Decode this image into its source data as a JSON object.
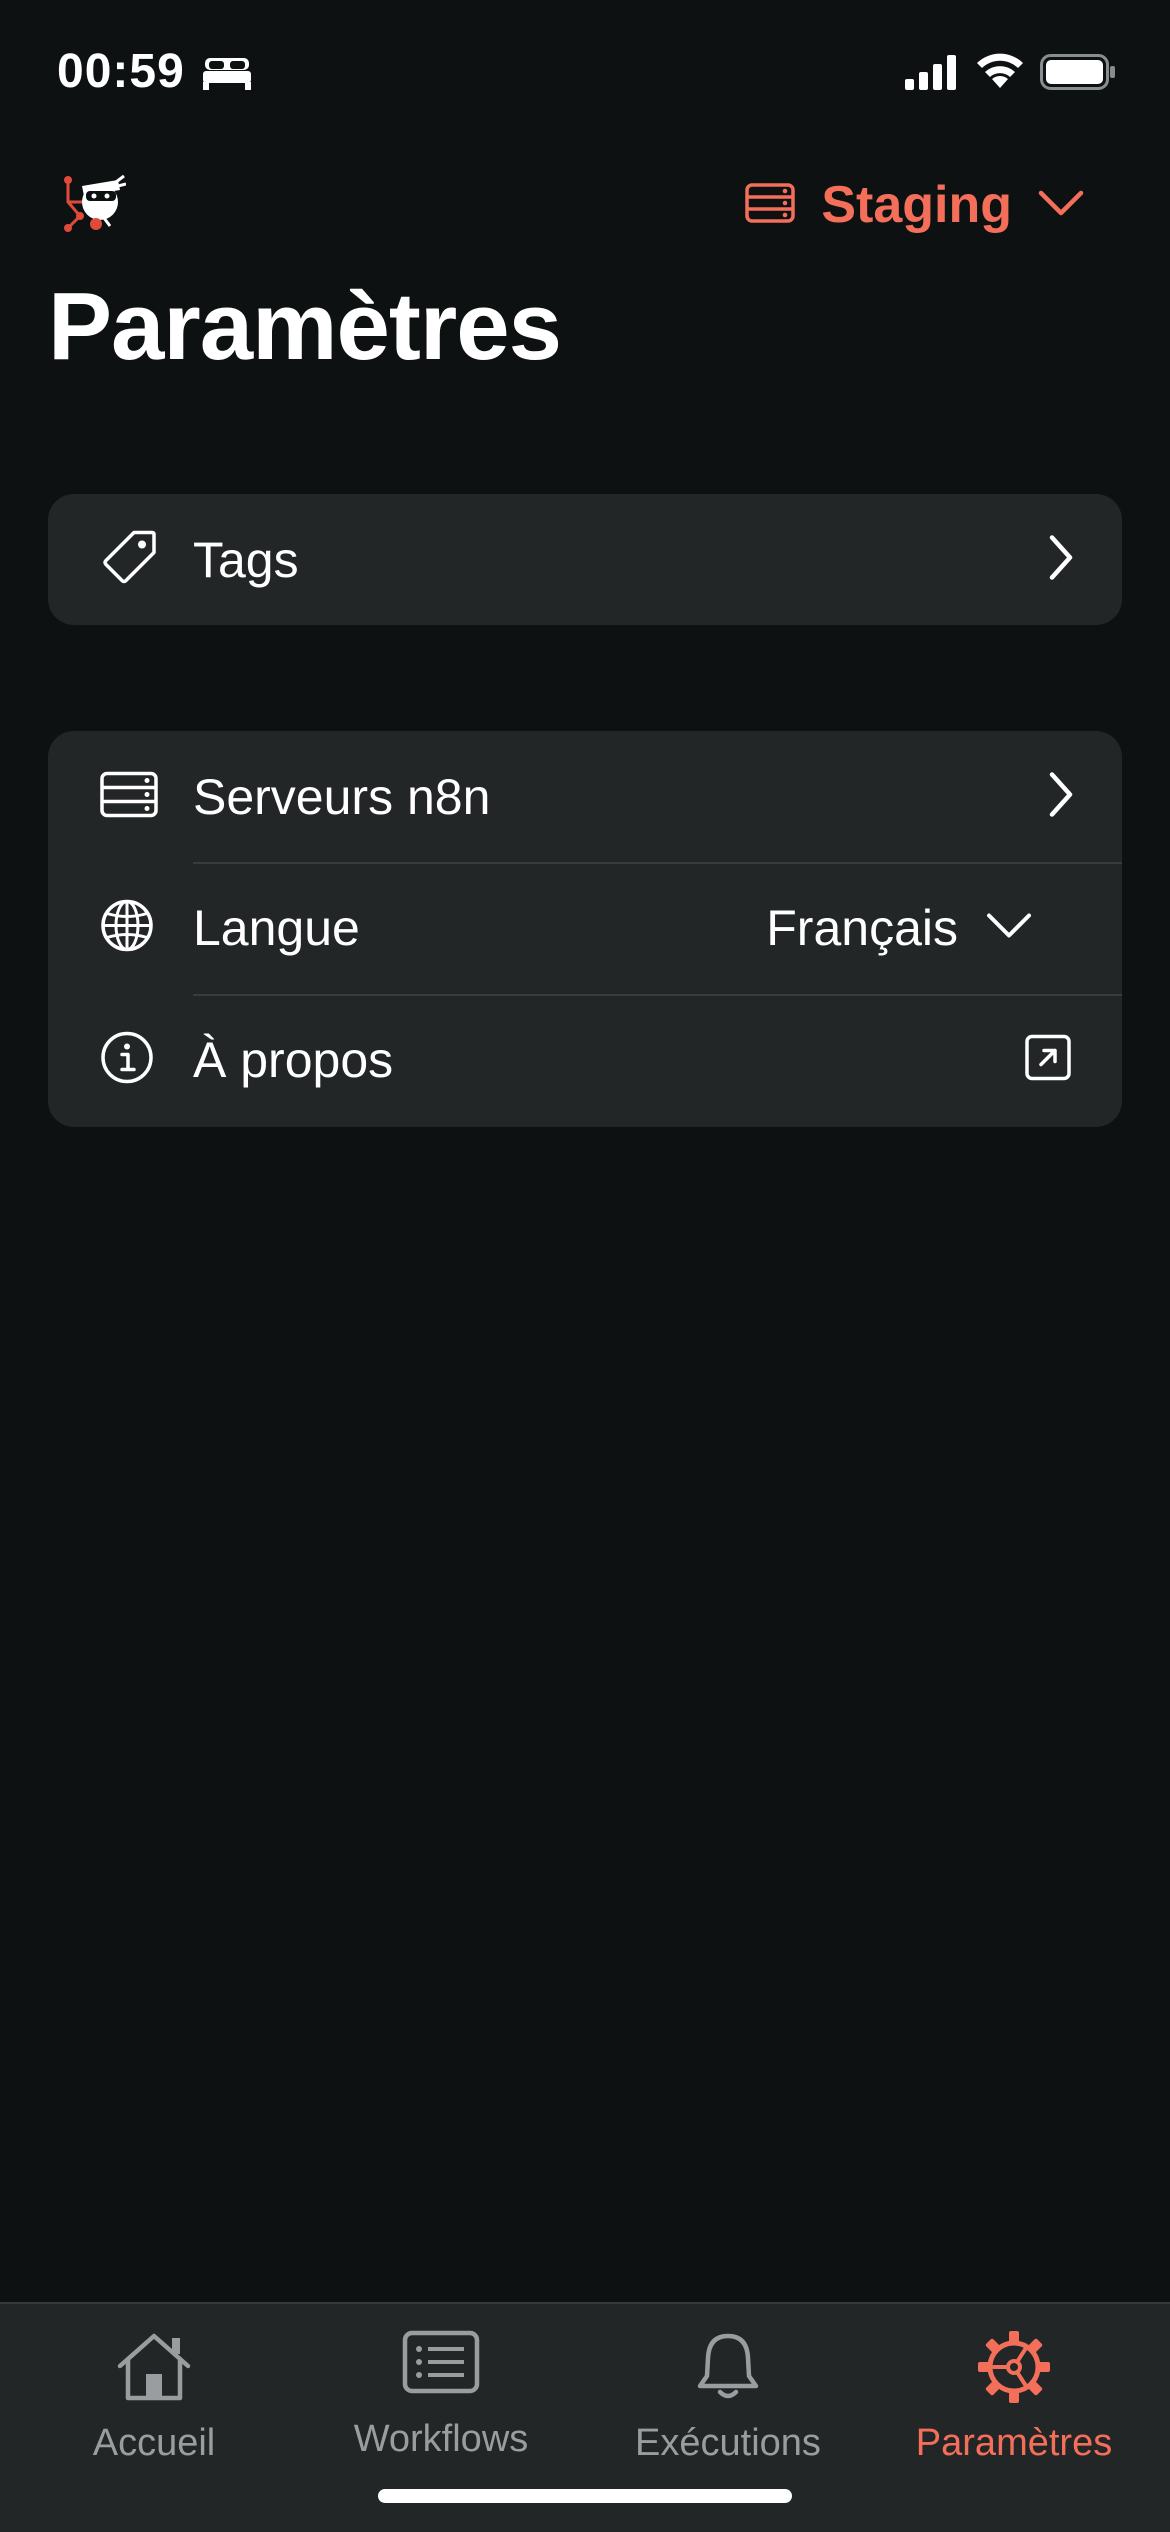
{
  "status_bar": {
    "time": "00:59",
    "icons": [
      "bed-icon",
      "signal-icon",
      "wifi-icon",
      "battery-icon"
    ]
  },
  "header": {
    "environment": "Staging",
    "title": "Paramètres"
  },
  "tags_card": {
    "label": "Tags"
  },
  "settings_card": {
    "servers_label": "Serveurs n8n",
    "language_label": "Langue",
    "language_value": "Français",
    "about_label": "À propos"
  },
  "tab_bar": {
    "tabs": [
      {
        "label": "Accueil",
        "icon": "house-icon"
      },
      {
        "label": "Workflows",
        "icon": "list-icon"
      },
      {
        "label": "Exécutions",
        "icon": "bell-icon"
      },
      {
        "label": "Paramètres",
        "icon": "gear-icon"
      }
    ],
    "active_index": 3
  },
  "colors": {
    "accent": "#f46f5a",
    "background": "#0d1112",
    "card": "#232627",
    "inactive_tab": "#9a9d9f"
  }
}
